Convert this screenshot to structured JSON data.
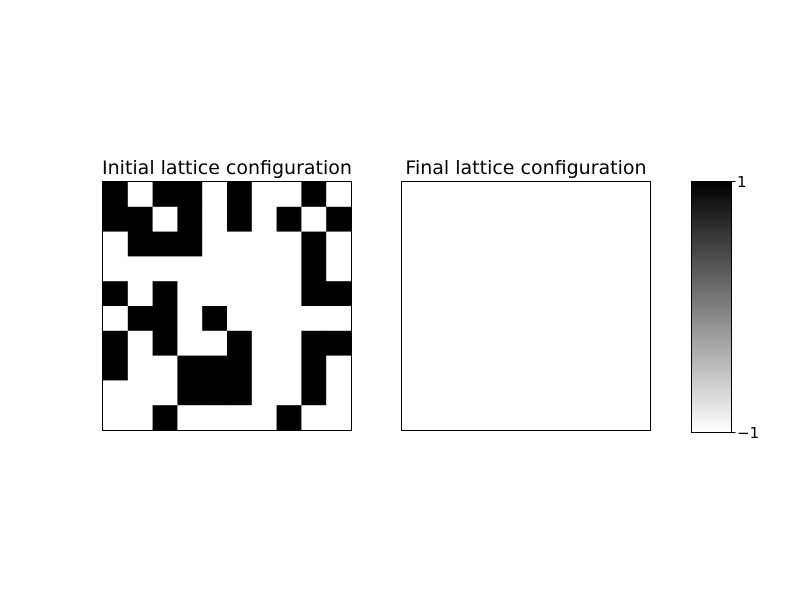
{
  "chart_data": [
    {
      "type": "heatmap",
      "title": "Initial lattice configuration",
      "rows": 10,
      "cols": 10,
      "vmin": -1,
      "vmax": 1,
      "cmap": "gray_r",
      "axes_ticks": false,
      "values": [
        [
          1,
          -1,
          1,
          1,
          -1,
          1,
          -1,
          -1,
          1,
          -1
        ],
        [
          1,
          1,
          -1,
          1,
          -1,
          1,
          -1,
          1,
          -1,
          1
        ],
        [
          -1,
          1,
          1,
          1,
          -1,
          -1,
          -1,
          -1,
          1,
          -1
        ],
        [
          -1,
          -1,
          -1,
          -1,
          -1,
          -1,
          -1,
          -1,
          1,
          -1
        ],
        [
          1,
          -1,
          1,
          -1,
          -1,
          -1,
          -1,
          -1,
          1,
          1
        ],
        [
          -1,
          1,
          1,
          -1,
          1,
          -1,
          -1,
          -1,
          -1,
          -1
        ],
        [
          1,
          -1,
          1,
          -1,
          -1,
          1,
          -1,
          -1,
          1,
          1
        ],
        [
          1,
          -1,
          -1,
          1,
          1,
          1,
          -1,
          -1,
          1,
          -1
        ],
        [
          -1,
          -1,
          -1,
          1,
          1,
          1,
          -1,
          -1,
          1,
          -1
        ],
        [
          -1,
          -1,
          1,
          -1,
          -1,
          -1,
          -1,
          1,
          -1,
          -1
        ]
      ]
    },
    {
      "type": "heatmap",
      "title": "Final lattice configuration",
      "rows": 10,
      "cols": 10,
      "vmin": -1,
      "vmax": 1,
      "cmap": "gray_r",
      "axes_ticks": false,
      "values": [
        [
          -1,
          -1,
          -1,
          -1,
          -1,
          -1,
          -1,
          -1,
          -1,
          -1
        ],
        [
          -1,
          -1,
          -1,
          -1,
          -1,
          -1,
          -1,
          -1,
          -1,
          -1
        ],
        [
          -1,
          -1,
          -1,
          -1,
          -1,
          -1,
          -1,
          -1,
          -1,
          -1
        ],
        [
          -1,
          -1,
          -1,
          -1,
          -1,
          -1,
          -1,
          -1,
          -1,
          -1
        ],
        [
          -1,
          -1,
          -1,
          -1,
          -1,
          -1,
          -1,
          -1,
          -1,
          -1
        ],
        [
          -1,
          -1,
          -1,
          -1,
          -1,
          -1,
          -1,
          -1,
          -1,
          -1
        ],
        [
          -1,
          -1,
          -1,
          -1,
          -1,
          -1,
          -1,
          -1,
          -1,
          -1
        ],
        [
          -1,
          -1,
          -1,
          -1,
          -1,
          -1,
          -1,
          -1,
          -1,
          -1
        ],
        [
          -1,
          -1,
          -1,
          -1,
          -1,
          -1,
          -1,
          -1,
          -1,
          -1
        ],
        [
          -1,
          -1,
          -1,
          -1,
          -1,
          -1,
          -1,
          -1,
          -1,
          -1
        ]
      ]
    }
  ],
  "colorbar": {
    "max_label": "1",
    "min_label": "−1",
    "color_high": "#000000",
    "color_low": "#ffffff"
  }
}
